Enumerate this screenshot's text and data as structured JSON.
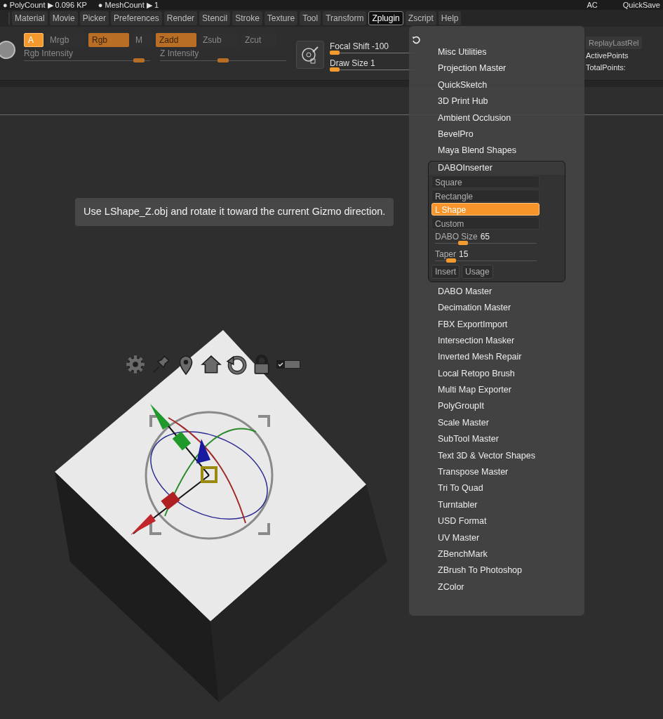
{
  "status_bar": {
    "left": [
      "● PolyCount ▶ 0.096 KP",
      "● MeshCount ▶ 1"
    ],
    "right": [
      "AC",
      "QuickSave"
    ]
  },
  "menu_bar": [
    {
      "label": "Material",
      "selected": false
    },
    {
      "label": "Movie",
      "selected": false
    },
    {
      "label": "Picker",
      "selected": false
    },
    {
      "label": "Preferences",
      "selected": false
    },
    {
      "label": "Render",
      "selected": false
    },
    {
      "label": "Stencil",
      "selected": false
    },
    {
      "label": "Stroke",
      "selected": false
    },
    {
      "label": "Texture",
      "selected": false
    },
    {
      "label": "Tool",
      "selected": false
    },
    {
      "label": "Transform",
      "selected": false
    },
    {
      "label": "Zplugin",
      "selected": true
    },
    {
      "label": "Zscript",
      "selected": false
    },
    {
      "label": "Help",
      "selected": false
    }
  ],
  "toolbar": {
    "toggles": [
      {
        "label": "A",
        "on": true
      },
      {
        "label": "Mrgb",
        "on": false
      },
      {
        "label": "Rgb",
        "on": true
      },
      {
        "label": "M",
        "on": false
      },
      {
        "label": "Zadd",
        "on": true
      },
      {
        "label": "Zsub",
        "on": false
      },
      {
        "label": "Zcut",
        "on": false
      }
    ],
    "sliders": [
      {
        "label": "Rgb Intensity",
        "level": 0.95
      },
      {
        "label": "Z Intensity",
        "level": 0.5
      }
    ],
    "brush_sliders": [
      {
        "label": "Focal Shift -100",
        "level": 0.0
      },
      {
        "label": "Draw Size 1",
        "level": 0.0
      }
    ],
    "buttons": [
      "ReplayLastRel"
    ],
    "readouts": [
      "ActivePoints",
      "TotalPoints:"
    ]
  },
  "zplugin_menu": {
    "items": [
      {
        "kind": "item",
        "label": "Misc Utilities"
      },
      {
        "kind": "item",
        "label": "Projection Master"
      },
      {
        "kind": "item",
        "label": "QuickSketch"
      },
      {
        "kind": "item",
        "label": "3D Print Hub"
      },
      {
        "kind": "item",
        "label": "Ambient Occlusion"
      },
      {
        "kind": "item",
        "label": "BevelPro"
      },
      {
        "kind": "item",
        "label": "Maya Blend Shapes"
      },
      {
        "kind": "panel",
        "label": "DABOInserter",
        "options": [
          {
            "label": "Square",
            "selected": false
          },
          {
            "label": "Rectangle",
            "selected": false
          },
          {
            "label": "L Shape",
            "selected": true
          },
          {
            "label": "Custom",
            "selected": false
          }
        ],
        "sliders": [
          {
            "label": "DABO Size",
            "value": "65",
            "level": 0.25
          },
          {
            "label": "Taper",
            "value": "15",
            "level": 0.12
          }
        ],
        "buttons": [
          "Insert",
          "Usage"
        ]
      },
      {
        "kind": "item",
        "label": "DABO Master"
      },
      {
        "kind": "item",
        "label": "Decimation Master"
      },
      {
        "kind": "item",
        "label": "FBX ExportImport"
      },
      {
        "kind": "item",
        "label": "Intersection Masker"
      },
      {
        "kind": "item",
        "label": "Inverted Mesh Repair"
      },
      {
        "kind": "item",
        "label": "Local Retopo Brush"
      },
      {
        "kind": "item",
        "label": "Multi Map Exporter"
      },
      {
        "kind": "item",
        "label": "PolyGroupIt"
      },
      {
        "kind": "item",
        "label": "Scale Master"
      },
      {
        "kind": "item",
        "label": "SubTool Master"
      },
      {
        "kind": "item",
        "label": "Text 3D & Vector Shapes"
      },
      {
        "kind": "item",
        "label": "Transpose Master"
      },
      {
        "kind": "item",
        "label": "Tri To Quad"
      },
      {
        "kind": "item",
        "label": "Turntabler"
      },
      {
        "kind": "item",
        "label": "USD Format"
      },
      {
        "kind": "item",
        "label": "UV Master"
      },
      {
        "kind": "item",
        "label": "ZBenchMark"
      },
      {
        "kind": "item",
        "label": "ZBrush To Photoshop"
      },
      {
        "kind": "item",
        "label": "ZColor"
      }
    ]
  },
  "viewport": {
    "tooltip": "Use LShape_Z.obj and rotate it toward the current Gizmo direction."
  }
}
